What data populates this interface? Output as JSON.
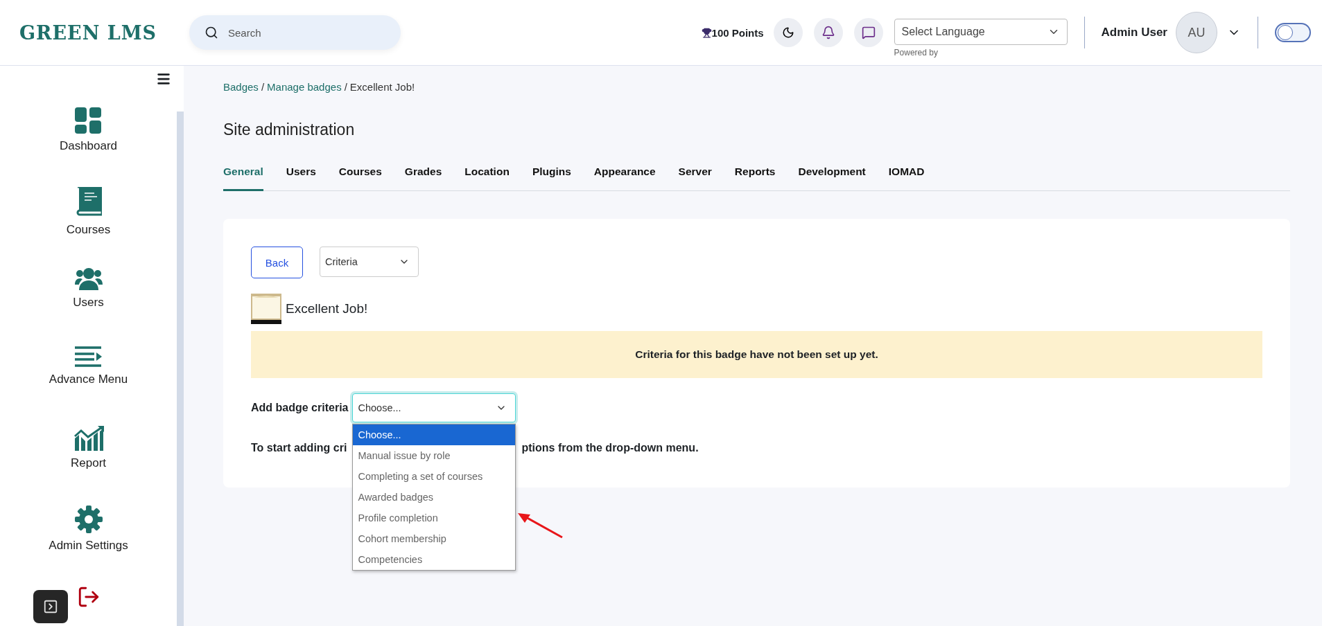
{
  "header": {
    "logo": "GREEN LMS",
    "search": {
      "placeholder": "Search"
    },
    "points": "100 Points",
    "language_select": {
      "value": "Select Language",
      "note": "Powered by"
    },
    "user": {
      "name": "Admin User",
      "initials": "AU"
    },
    "theme_toggle": {
      "on": false
    }
  },
  "sidebar": {
    "items": [
      {
        "label": "Dashboard"
      },
      {
        "label": "Courses"
      },
      {
        "label": "Users"
      },
      {
        "label": "Advance Menu"
      },
      {
        "label": "Report"
      },
      {
        "label": "Admin Settings"
      }
    ]
  },
  "breadcrumb": [
    {
      "label": "Badges",
      "link": true,
      "separator": "/"
    },
    {
      "label": "Manage badges",
      "link": true,
      "separator": "/"
    },
    {
      "label": "Excellent Job!",
      "link": false
    }
  ],
  "page_title": "Site administration",
  "tabs": [
    {
      "label": "General",
      "selected": true
    },
    {
      "label": "Users",
      "selected": false
    },
    {
      "label": "Courses",
      "selected": false
    },
    {
      "label": "Grades",
      "selected": false
    },
    {
      "label": "Location",
      "selected": false
    },
    {
      "label": "Plugins",
      "selected": false
    },
    {
      "label": "Appearance",
      "selected": false
    },
    {
      "label": "Server",
      "selected": false
    },
    {
      "label": "Reports",
      "selected": false
    },
    {
      "label": "Development",
      "selected": false
    },
    {
      "label": "IOMAD",
      "selected": false
    }
  ],
  "card": {
    "back_button": "Back",
    "view_select": "Criteria",
    "badge_name": "Excellent Job!",
    "alert": "Criteria for this badge have not been set up yet.",
    "criteria_label": "Add badge criteria",
    "criteria_select": "Choose...",
    "criteria_options": [
      {
        "label": "Choose...",
        "selected": true
      },
      {
        "label": "Manual issue by role",
        "selected": false
      },
      {
        "label": "Completing a set of courses",
        "selected": false
      },
      {
        "label": "Awarded badges",
        "selected": false
      },
      {
        "label": "Profile completion",
        "selected": false
      },
      {
        "label": "Cohort membership",
        "selected": false
      },
      {
        "label": "Competencies",
        "selected": false
      }
    ],
    "hint_start": "To start adding cri",
    "hint_end": "ptions from the drop-down menu."
  }
}
